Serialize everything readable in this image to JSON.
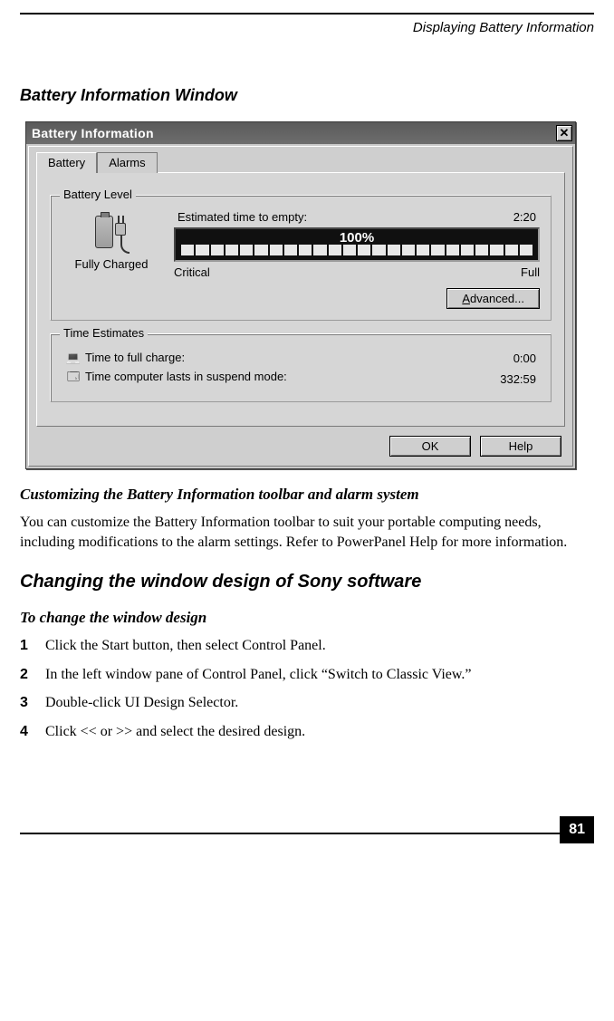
{
  "header": {
    "running": "Displaying Battery Information"
  },
  "section1_title": "Battery Information Window",
  "window": {
    "title": "Battery Information",
    "tabs": {
      "battery": "Battery",
      "alarms": "Alarms"
    },
    "batteryLevel": {
      "legend": "Battery Level",
      "status": "Fully Charged",
      "estimatedLabel": "Estimated time to empty:",
      "estimatedValue": "2:20",
      "percent": "100%",
      "scaleLeft": "Critical",
      "scaleRight": "Full",
      "advancedBtn": "Advanced..."
    },
    "timeEstimates": {
      "legend": "Time Estimates",
      "fullChargeLabel": "Time to full charge:",
      "fullChargeValue": "0:00",
      "suspendLabel": "Time computer lasts in suspend mode:",
      "suspendValue": "332:59"
    },
    "buttons": {
      "ok": "OK",
      "help": "Help"
    }
  },
  "section2_title": "Customizing the Battery Information toolbar and alarm system",
  "section2_body": "You can customize the Battery Information toolbar to suit your portable computing needs, including modifications to the alarm settings. Refer to PowerPanel Help for more information.",
  "section3_title": "Changing the window design of Sony software",
  "section3_sub": "To change the window design",
  "steps": [
    "Click the Start button, then select Control Panel.",
    "In the left window pane of Control Panel, click “Switch to Classic View.”",
    "Double-click UI Design Selector.",
    "Click << or >> and select the desired design."
  ],
  "pageNumber": "81"
}
